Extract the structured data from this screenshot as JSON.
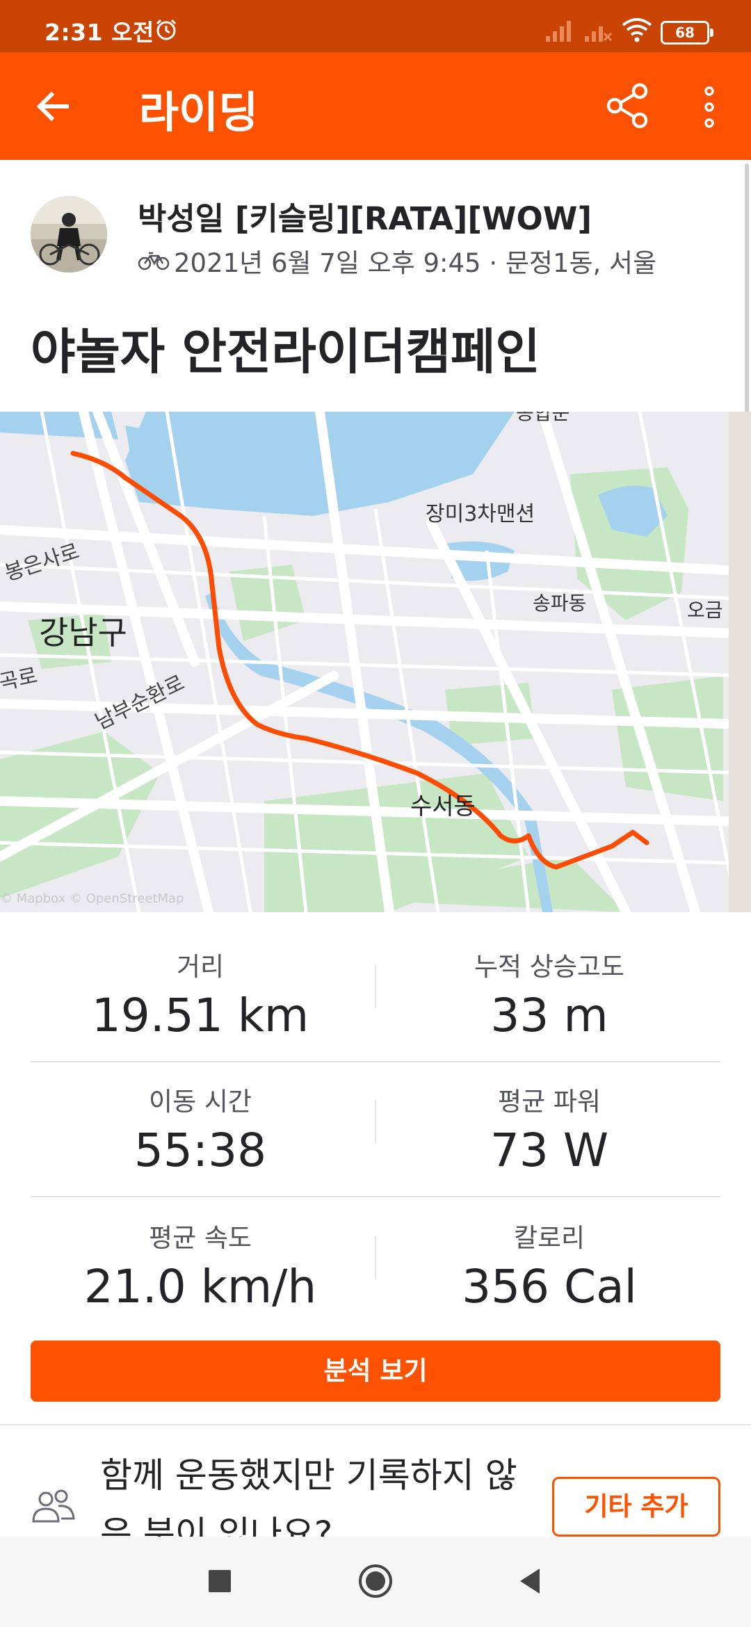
{
  "status_bar": {
    "time": "2:31 오전",
    "battery": "68"
  },
  "app_bar": {
    "title": "라이딩"
  },
  "activity": {
    "athlete_name": "박성일 [키슬링][RATA][WOW]",
    "meta": "2021년 6월 7일 오후 9:45 · 문정1동, 서울",
    "title": "야놀자 안전라이더캠페인"
  },
  "map": {
    "labels": {
      "apartment": "장미3차맨션",
      "songpa": "송파동",
      "gangnam": "강남구",
      "bongeun": "봉은사로",
      "nambu": "남부순환로",
      "suseo": "수서동",
      "top_partial": "종합운",
      "right_partial": "오금",
      "left_partial": "곡로",
      "attribution": "© Mapbox © OpenStreetMap"
    },
    "route_color": "#fc4c02"
  },
  "stats": [
    {
      "label": "거리",
      "value": "19.51 km"
    },
    {
      "label": "누적 상승고도",
      "value": "33 m"
    },
    {
      "label": "이동 시간",
      "value": "55:38"
    },
    {
      "label": "평균 파워",
      "value": "73 W"
    },
    {
      "label": "평균 속도",
      "value": "21.0 km/h"
    },
    {
      "label": "칼로리",
      "value": "356 Cal"
    }
  ],
  "analysis_button": "분석 보기",
  "together": {
    "text": "함께 운동했지만 기록하지 않은 분이 있나요?",
    "add_button": "기타 추가"
  },
  "colors": {
    "accent": "#fc5200",
    "status_bar": "#c94402"
  }
}
